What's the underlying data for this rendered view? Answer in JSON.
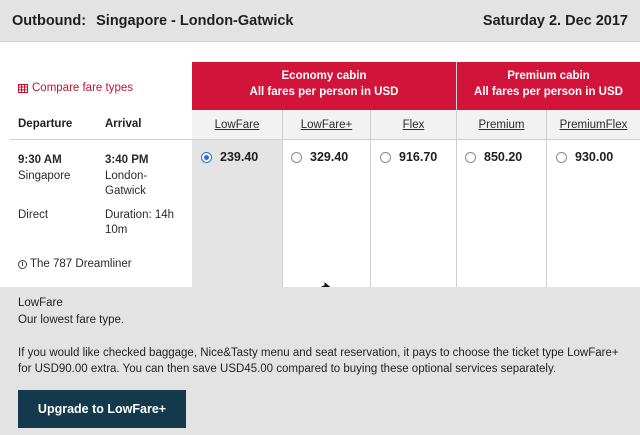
{
  "header": {
    "route_label": "Outbound:",
    "route": "Singapore - London-Gatwick",
    "date": "Saturday 2. Dec 2017"
  },
  "left": {
    "compare_link": "Compare fare types",
    "departure_header": "Departure",
    "arrival_header": "Arrival",
    "dep_time": "9:30 AM",
    "dep_city": "Singapore",
    "arr_time": "3:40 PM",
    "arr_city": "London-Gatwick",
    "stops": "Direct",
    "duration": "Duration: 14h 10m",
    "aircraft": "The 787 Dreamliner"
  },
  "cabins": [
    {
      "name": "Economy cabin",
      "sub": "All fares per person in USD"
    },
    {
      "name": "Premium cabin",
      "sub": "All fares per person in USD"
    }
  ],
  "fares": [
    {
      "name": "LowFare",
      "price": "239.40",
      "selected": true
    },
    {
      "name": "LowFare+",
      "price": "329.40",
      "selected": false
    },
    {
      "name": "Flex",
      "price": "916.70",
      "selected": false
    },
    {
      "name": "Premium",
      "price": "850.20",
      "selected": false
    },
    {
      "name": "PremiumFlex",
      "price": "930.00",
      "selected": false
    }
  ],
  "info": {
    "title": "LowFare",
    "subtitle": "Our lowest fare type.",
    "body": "If you would like checked baggage, Nice&Tasty menu and seat reservation, it pays to choose the ticket type LowFare+ for USD90.00 extra. You can then save USD45.00 compared to buying these optional services separately.",
    "button": "Upgrade to LowFare+"
  },
  "colors": {
    "accent_red": "#d2143a",
    "button_navy": "#123a4c",
    "radio_blue": "#2d6fd6"
  }
}
